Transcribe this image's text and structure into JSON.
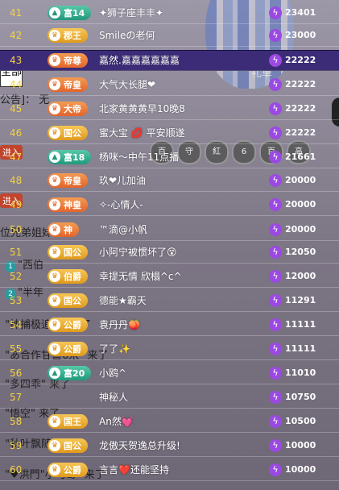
{
  "background": {
    "tab_all": "全部",
    "gift_label": "礼单",
    "notice": "公告]：",
    "notice_sub": "无",
    "welcome": "位兄弟姐妹们",
    "chats": [
      {
        "num": "1",
        "text": "\"西伯"
      },
      {
        "num": "2",
        "text": "\"半年"
      },
      {
        "num": "",
        "text": "\"神捕极追综\" 来了"
      },
      {
        "num": "",
        "text": "\"あ合作甘喜6米\" 来了"
      },
      {
        "num": "",
        "text": "\"多四乖\" 来了"
      },
      {
        "num": "",
        "text": "\"悟空\" 来了"
      },
      {
        "num": "",
        "text": "\"秋叶飘随\" 来了"
      },
      {
        "num": "",
        "text": "\"♥洪門\"小马哥\" 来了"
      }
    ],
    "red_labels": [
      "进入",
      "进入"
    ],
    "badges": [
      "百",
      "守",
      "紅",
      "6",
      "百",
      "高"
    ]
  },
  "rows": [
    {
      "rank": "41",
      "badge": "富14",
      "style": "teal",
      "icon": "▲",
      "name": "✦狮子座丰丰✦",
      "score": "23401"
    },
    {
      "rank": "42",
      "badge": "郡王",
      "style": "gold",
      "icon": "♛",
      "name": "Smileの老何",
      "score": "23000"
    },
    {
      "rank": "43",
      "badge": "帝尊",
      "style": "orange",
      "icon": "♛",
      "name": "嘉然.嘉嘉嘉嘉嘉嘉",
      "score": "22222",
      "highlight": true
    },
    {
      "rank": "44",
      "badge": "帝皇",
      "style": "orange",
      "icon": "♛",
      "name": "大气大长腿❤",
      "score": "22222"
    },
    {
      "rank": "45",
      "badge": "大帝",
      "style": "orange",
      "icon": "♛",
      "name": "北家黄黄黄早10晚8",
      "score": "22222"
    },
    {
      "rank": "46",
      "badge": "国公",
      "style": "gold",
      "icon": "♛",
      "name": "蜜大宝 💋 平安顺遂",
      "score": "22222"
    },
    {
      "rank": "47",
      "badge": "富18",
      "style": "teal",
      "icon": "▲",
      "name": "杨咪～中午11点播",
      "score": "21661"
    },
    {
      "rank": "48",
      "badge": "帝皇",
      "style": "orange",
      "icon": "♛",
      "name": "玖❤儿加油",
      "score": "20000"
    },
    {
      "rank": "49",
      "badge": "神皇",
      "style": "orange",
      "icon": "♛",
      "name": "✧-心情人-",
      "score": "20000"
    },
    {
      "rank": "50",
      "badge": "神",
      "style": "orange",
      "icon": "♛",
      "name": "™滴@小帆",
      "score": "20000"
    },
    {
      "rank": "51",
      "badge": "国公",
      "style": "gold",
      "icon": "♛",
      "name": "小阿宁被惯坏了😵",
      "score": "12050"
    },
    {
      "rank": "52",
      "badge": "伯爵",
      "style": "gold",
      "icon": "♛",
      "name": "幸提无情 欣榻^c^",
      "score": "12000"
    },
    {
      "rank": "53",
      "badge": "国公",
      "style": "gold",
      "icon": "♛",
      "name": "德能★霸天",
      "score": "11291"
    },
    {
      "rank": "54",
      "badge": "公爵",
      "style": "gold",
      "icon": "♛",
      "name": "袁丹丹🍑",
      "score": "11111"
    },
    {
      "rank": "55",
      "badge": "公爵",
      "style": "gold",
      "icon": "♛",
      "name": "了了✨",
      "score": "11111"
    },
    {
      "rank": "56",
      "badge": "富20",
      "style": "teal",
      "icon": "▲",
      "name": "小鸥^",
      "score": "11010"
    },
    {
      "rank": "57",
      "badge": "",
      "style": "none",
      "icon": "",
      "name": "神秘人",
      "score": "10750"
    },
    {
      "rank": "58",
      "badge": "国王",
      "style": "gold",
      "icon": "♛",
      "name": "An然💓",
      "score": "10500"
    },
    {
      "rank": "59",
      "badge": "国公",
      "style": "gold",
      "icon": "♛",
      "name": "龙傲天贺逸总升级!",
      "score": "10000"
    },
    {
      "rank": "60",
      "badge": "公爵",
      "style": "gold",
      "icon": "♛",
      "name": "言言❤️还能坚持",
      "score": "10000"
    }
  ],
  "coin_icon": "ϟ"
}
